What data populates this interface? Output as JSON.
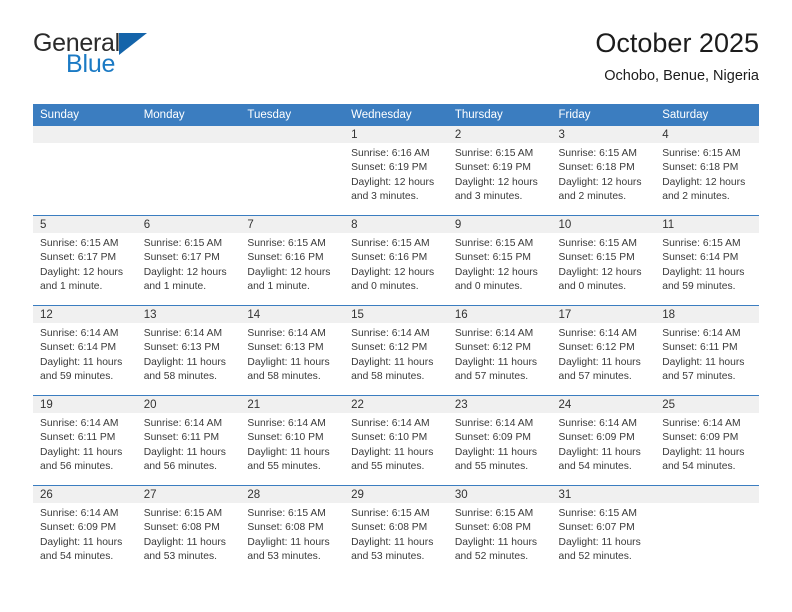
{
  "logo": {
    "text_primary": "General",
    "text_secondary": "Blue",
    "triangle_color": "#1464aa",
    "primary_color": "#2b2b2b",
    "secondary_color": "#1b7ac4"
  },
  "header": {
    "title": "October 2025",
    "subtitle": "Ochobo, Benue, Nigeria"
  },
  "theme": {
    "header_blue": "#3b7dc0",
    "daynum_band": "#f0f0f0",
    "text": "#3a3a3a"
  },
  "weekdays": [
    "Sunday",
    "Monday",
    "Tuesday",
    "Wednesday",
    "Thursday",
    "Friday",
    "Saturday"
  ],
  "labels": {
    "sunrise": "Sunrise:",
    "sunset": "Sunset:",
    "daylight": "Daylight:"
  },
  "weeks": [
    [
      {
        "day": "",
        "sunrise": "",
        "sunset": "",
        "daylight_line1": "",
        "daylight_line2": ""
      },
      {
        "day": "",
        "sunrise": "",
        "sunset": "",
        "daylight_line1": "",
        "daylight_line2": ""
      },
      {
        "day": "",
        "sunrise": "",
        "sunset": "",
        "daylight_line1": "",
        "daylight_line2": ""
      },
      {
        "day": "1",
        "sunrise": "Sunrise: 6:16 AM",
        "sunset": "Sunset: 6:19 PM",
        "daylight_line1": "Daylight: 12 hours",
        "daylight_line2": "and 3 minutes."
      },
      {
        "day": "2",
        "sunrise": "Sunrise: 6:15 AM",
        "sunset": "Sunset: 6:19 PM",
        "daylight_line1": "Daylight: 12 hours",
        "daylight_line2": "and 3 minutes."
      },
      {
        "day": "3",
        "sunrise": "Sunrise: 6:15 AM",
        "sunset": "Sunset: 6:18 PM",
        "daylight_line1": "Daylight: 12 hours",
        "daylight_line2": "and 2 minutes."
      },
      {
        "day": "4",
        "sunrise": "Sunrise: 6:15 AM",
        "sunset": "Sunset: 6:18 PM",
        "daylight_line1": "Daylight: 12 hours",
        "daylight_line2": "and 2 minutes."
      }
    ],
    [
      {
        "day": "5",
        "sunrise": "Sunrise: 6:15 AM",
        "sunset": "Sunset: 6:17 PM",
        "daylight_line1": "Daylight: 12 hours",
        "daylight_line2": "and 1 minute."
      },
      {
        "day": "6",
        "sunrise": "Sunrise: 6:15 AM",
        "sunset": "Sunset: 6:17 PM",
        "daylight_line1": "Daylight: 12 hours",
        "daylight_line2": "and 1 minute."
      },
      {
        "day": "7",
        "sunrise": "Sunrise: 6:15 AM",
        "sunset": "Sunset: 6:16 PM",
        "daylight_line1": "Daylight: 12 hours",
        "daylight_line2": "and 1 minute."
      },
      {
        "day": "8",
        "sunrise": "Sunrise: 6:15 AM",
        "sunset": "Sunset: 6:16 PM",
        "daylight_line1": "Daylight: 12 hours",
        "daylight_line2": "and 0 minutes."
      },
      {
        "day": "9",
        "sunrise": "Sunrise: 6:15 AM",
        "sunset": "Sunset: 6:15 PM",
        "daylight_line1": "Daylight: 12 hours",
        "daylight_line2": "and 0 minutes."
      },
      {
        "day": "10",
        "sunrise": "Sunrise: 6:15 AM",
        "sunset": "Sunset: 6:15 PM",
        "daylight_line1": "Daylight: 12 hours",
        "daylight_line2": "and 0 minutes."
      },
      {
        "day": "11",
        "sunrise": "Sunrise: 6:15 AM",
        "sunset": "Sunset: 6:14 PM",
        "daylight_line1": "Daylight: 11 hours",
        "daylight_line2": "and 59 minutes."
      }
    ],
    [
      {
        "day": "12",
        "sunrise": "Sunrise: 6:14 AM",
        "sunset": "Sunset: 6:14 PM",
        "daylight_line1": "Daylight: 11 hours",
        "daylight_line2": "and 59 minutes."
      },
      {
        "day": "13",
        "sunrise": "Sunrise: 6:14 AM",
        "sunset": "Sunset: 6:13 PM",
        "daylight_line1": "Daylight: 11 hours",
        "daylight_line2": "and 58 minutes."
      },
      {
        "day": "14",
        "sunrise": "Sunrise: 6:14 AM",
        "sunset": "Sunset: 6:13 PM",
        "daylight_line1": "Daylight: 11 hours",
        "daylight_line2": "and 58 minutes."
      },
      {
        "day": "15",
        "sunrise": "Sunrise: 6:14 AM",
        "sunset": "Sunset: 6:12 PM",
        "daylight_line1": "Daylight: 11 hours",
        "daylight_line2": "and 58 minutes."
      },
      {
        "day": "16",
        "sunrise": "Sunrise: 6:14 AM",
        "sunset": "Sunset: 6:12 PM",
        "daylight_line1": "Daylight: 11 hours",
        "daylight_line2": "and 57 minutes."
      },
      {
        "day": "17",
        "sunrise": "Sunrise: 6:14 AM",
        "sunset": "Sunset: 6:12 PM",
        "daylight_line1": "Daylight: 11 hours",
        "daylight_line2": "and 57 minutes."
      },
      {
        "day": "18",
        "sunrise": "Sunrise: 6:14 AM",
        "sunset": "Sunset: 6:11 PM",
        "daylight_line1": "Daylight: 11 hours",
        "daylight_line2": "and 57 minutes."
      }
    ],
    [
      {
        "day": "19",
        "sunrise": "Sunrise: 6:14 AM",
        "sunset": "Sunset: 6:11 PM",
        "daylight_line1": "Daylight: 11 hours",
        "daylight_line2": "and 56 minutes."
      },
      {
        "day": "20",
        "sunrise": "Sunrise: 6:14 AM",
        "sunset": "Sunset: 6:11 PM",
        "daylight_line1": "Daylight: 11 hours",
        "daylight_line2": "and 56 minutes."
      },
      {
        "day": "21",
        "sunrise": "Sunrise: 6:14 AM",
        "sunset": "Sunset: 6:10 PM",
        "daylight_line1": "Daylight: 11 hours",
        "daylight_line2": "and 55 minutes."
      },
      {
        "day": "22",
        "sunrise": "Sunrise: 6:14 AM",
        "sunset": "Sunset: 6:10 PM",
        "daylight_line1": "Daylight: 11 hours",
        "daylight_line2": "and 55 minutes."
      },
      {
        "day": "23",
        "sunrise": "Sunrise: 6:14 AM",
        "sunset": "Sunset: 6:09 PM",
        "daylight_line1": "Daylight: 11 hours",
        "daylight_line2": "and 55 minutes."
      },
      {
        "day": "24",
        "sunrise": "Sunrise: 6:14 AM",
        "sunset": "Sunset: 6:09 PM",
        "daylight_line1": "Daylight: 11 hours",
        "daylight_line2": "and 54 minutes."
      },
      {
        "day": "25",
        "sunrise": "Sunrise: 6:14 AM",
        "sunset": "Sunset: 6:09 PM",
        "daylight_line1": "Daylight: 11 hours",
        "daylight_line2": "and 54 minutes."
      }
    ],
    [
      {
        "day": "26",
        "sunrise": "Sunrise: 6:14 AM",
        "sunset": "Sunset: 6:09 PM",
        "daylight_line1": "Daylight: 11 hours",
        "daylight_line2": "and 54 minutes."
      },
      {
        "day": "27",
        "sunrise": "Sunrise: 6:15 AM",
        "sunset": "Sunset: 6:08 PM",
        "daylight_line1": "Daylight: 11 hours",
        "daylight_line2": "and 53 minutes."
      },
      {
        "day": "28",
        "sunrise": "Sunrise: 6:15 AM",
        "sunset": "Sunset: 6:08 PM",
        "daylight_line1": "Daylight: 11 hours",
        "daylight_line2": "and 53 minutes."
      },
      {
        "day": "29",
        "sunrise": "Sunrise: 6:15 AM",
        "sunset": "Sunset: 6:08 PM",
        "daylight_line1": "Daylight: 11 hours",
        "daylight_line2": "and 53 minutes."
      },
      {
        "day": "30",
        "sunrise": "Sunrise: 6:15 AM",
        "sunset": "Sunset: 6:08 PM",
        "daylight_line1": "Daylight: 11 hours",
        "daylight_line2": "and 52 minutes."
      },
      {
        "day": "31",
        "sunrise": "Sunrise: 6:15 AM",
        "sunset": "Sunset: 6:07 PM",
        "daylight_line1": "Daylight: 11 hours",
        "daylight_line2": "and 52 minutes."
      },
      {
        "day": "",
        "sunrise": "",
        "sunset": "",
        "daylight_line1": "",
        "daylight_line2": ""
      }
    ]
  ]
}
